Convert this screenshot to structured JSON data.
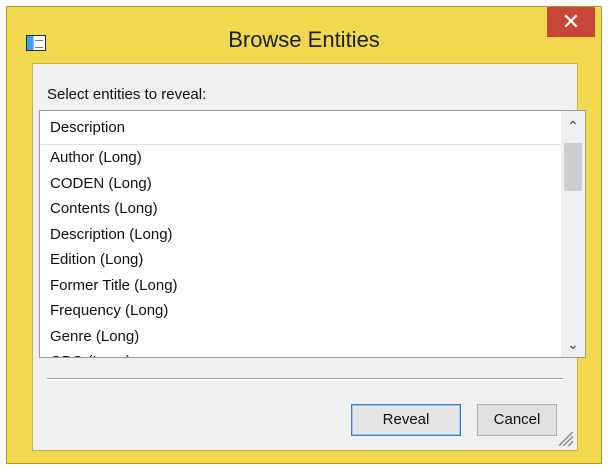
{
  "window": {
    "title": "Browse Entities",
    "close_glyph": "✕"
  },
  "dialog": {
    "prompt": "Select entities to reveal:",
    "list": {
      "column_header": "Description",
      "items": [
        "Author (Long)",
        "CODEN (Long)",
        "Contents (Long)",
        "Description (Long)",
        "Edition (Long)",
        "Former Title (Long)",
        "Frequency (Long)",
        "Genre (Long)",
        "GPO (Long)"
      ]
    },
    "buttons": {
      "reveal": "Reveal",
      "cancel": "Cancel"
    },
    "scroll_up_glyph": "⌃",
    "scroll_down_glyph": "⌄"
  },
  "colors": {
    "frame": "#f0d94e",
    "close": "#c8463a",
    "default_button_border": "#3c7fd1"
  }
}
